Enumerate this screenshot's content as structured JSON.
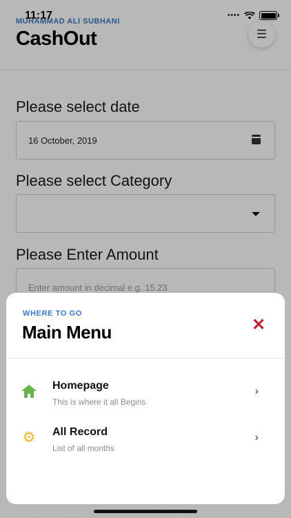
{
  "status_bar": {
    "time": "11:17"
  },
  "header": {
    "subtitle": "MUHAMMAD ALI SUBHANI",
    "title": "CashOut",
    "menu_icon": "hamburger-menu-icon"
  },
  "form": {
    "date_label": "Please select date",
    "date_value": "16 October, 2019",
    "category_label": "Please select Category",
    "category_value": "",
    "amount_label": "Please Enter Amount",
    "amount_placeholder": "Enter amount in decimal e.g. 15.23"
  },
  "sheet": {
    "kicker": "WHERE TO GO",
    "title": "Main Menu",
    "items": [
      {
        "title": "Homepage",
        "subtitle": "This is where it all Begins",
        "icon": "home-icon"
      },
      {
        "title": "All Record",
        "subtitle": "List of all months",
        "icon": "gear-icon"
      }
    ]
  },
  "colors": {
    "accent_blue": "#3a78c3",
    "close_red": "#c0243a",
    "home_green": "#69b34c",
    "gear_yellow": "#f2b52c"
  }
}
